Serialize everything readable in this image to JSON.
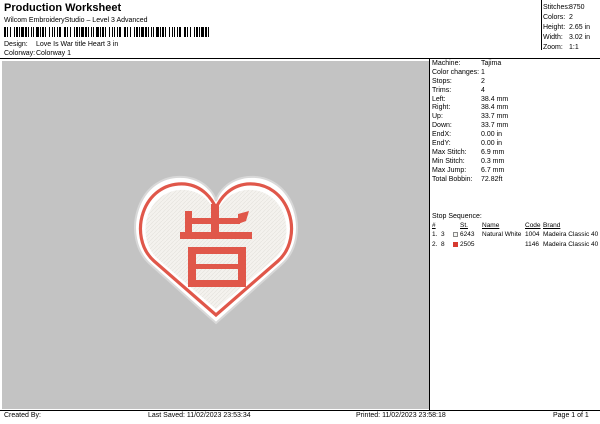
{
  "header": {
    "title": "Production Worksheet",
    "software": "Wilcom EmbroideryStudio – Level 3 Advanced",
    "design_label": "Design:",
    "design_value": "Love Is War title Heart 3 in",
    "colorway_label": "Colorway:",
    "colorway_value": "Colorway 1"
  },
  "summary": [
    {
      "label": "Stitches:",
      "value": "8750"
    },
    {
      "label": "Colors:",
      "value": "2"
    },
    {
      "label": "Height:",
      "value": "2.65 in"
    },
    {
      "label": "Width:",
      "value": "3.02 in"
    },
    {
      "label": "Zoom:",
      "value": "1:1"
    }
  ],
  "details": [
    {
      "label": "Machine:",
      "value": "Tajima"
    },
    {
      "label": "Color changes:",
      "value": "1"
    },
    {
      "label": "Stops:",
      "value": "2"
    },
    {
      "label": "Trims:",
      "value": "4"
    },
    {
      "label": "Left:",
      "value": "38.4 mm"
    },
    {
      "label": "Right:",
      "value": "38.4 mm"
    },
    {
      "label": "Up:",
      "value": "33.7 mm"
    },
    {
      "label": "Down:",
      "value": "33.7 mm"
    },
    {
      "label": "EndX:",
      "value": "0.00 in"
    },
    {
      "label": "EndY:",
      "value": "0.00 in"
    },
    {
      "label": "Max Stitch:",
      "value": "6.9 mm"
    },
    {
      "label": "Min Stitch:",
      "value": "0.3 mm"
    },
    {
      "label": "Max Jump:",
      "value": "6.7 mm"
    },
    {
      "label": "Total Bobbin:",
      "value": "72.82ft"
    }
  ],
  "stop_sequence": {
    "label": "Stop Sequence:",
    "headers": {
      "n": "#",
      "st": "St.",
      "name": "Name",
      "code": "Code",
      "brand": "Brand"
    },
    "rows": [
      {
        "idx": "1.",
        "n": "3",
        "color": "#f4f4f0",
        "st": "6243",
        "name": "Natural White",
        "code": "1004",
        "brand": "Madeira Classic 40"
      },
      {
        "idx": "2.",
        "n": "8",
        "color": "#d63a30",
        "st": "2505",
        "name": "",
        "code": "1146",
        "brand": "Madeira Classic 40"
      }
    ]
  },
  "footer": {
    "created_by": "Created By:",
    "last_saved": "Last Saved: 11/02/2023 23:53:34",
    "printed": "Printed: 11/02/2023 23:58:18",
    "page": "Page 1 of 1"
  },
  "design_preview": {
    "glyph": "告",
    "fill_color": "#f4f2ee",
    "thread_color": "#e0574a",
    "canvas_color": "#c3c3c3"
  }
}
